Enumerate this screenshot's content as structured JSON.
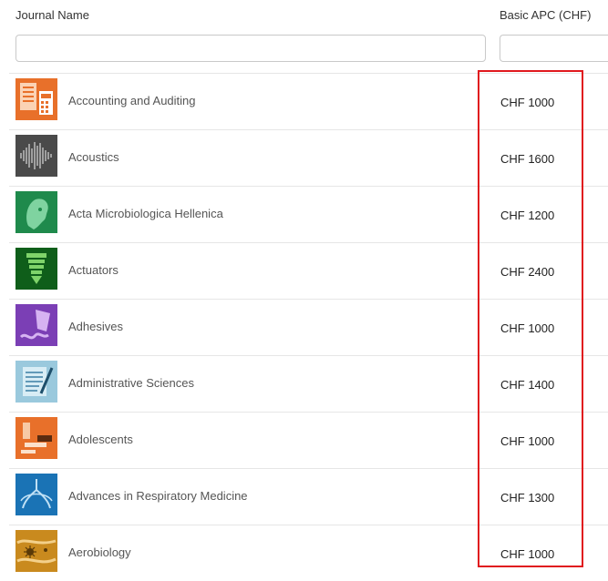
{
  "header": {
    "journal_name_label": "Journal Name",
    "apc_label": "Basic APC (CHF)"
  },
  "filters": {
    "journal_name_value": "",
    "apc_value": ""
  },
  "colors": {
    "highlight_border": "#e0191e"
  },
  "rows": [
    {
      "name": "Accounting and Auditing",
      "apc": "CHF 1000",
      "icon": "accounting-cover-icon",
      "color": "#e8702a"
    },
    {
      "name": "Acoustics",
      "apc": "CHF 1600",
      "icon": "acoustics-cover-icon",
      "color": "#4a4a4a"
    },
    {
      "name": "Acta Microbiologica Hellenica",
      "apc": "CHF 1200",
      "icon": "acta-microbiologica-cover-icon",
      "color": "#1f8a4c"
    },
    {
      "name": "Actuators",
      "apc": "CHF 2400",
      "icon": "actuators-cover-icon",
      "color": "#0f5e1a"
    },
    {
      "name": "Adhesives",
      "apc": "CHF 1000",
      "icon": "adhesives-cover-icon",
      "color": "#7b3fb5"
    },
    {
      "name": "Administrative Sciences",
      "apc": "CHF 1400",
      "icon": "administrative-sciences-cover-icon",
      "color": "#9ac9dd"
    },
    {
      "name": "Adolescents",
      "apc": "CHF 1000",
      "icon": "adolescents-cover-icon",
      "color": "#e8702a"
    },
    {
      "name": "Advances in Respiratory Medicine",
      "apc": "CHF 1300",
      "icon": "respiratory-medicine-cover-icon",
      "color": "#1a73b5"
    },
    {
      "name": "Aerobiology",
      "apc": "CHF 1000",
      "icon": "aerobiology-cover-icon",
      "color": "#c98a1e"
    }
  ]
}
